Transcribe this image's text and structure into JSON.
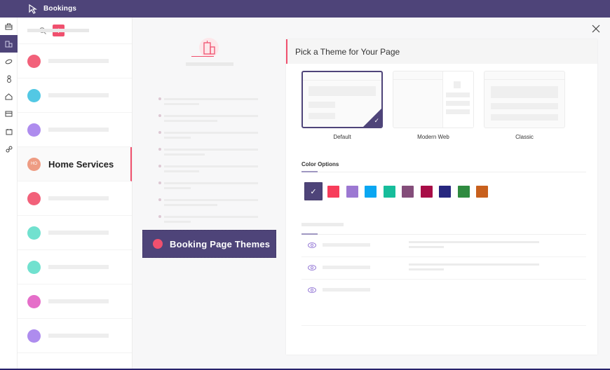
{
  "app": {
    "title": "Bookings",
    "logo_icon": "cursor-click-icon"
  },
  "rail": {
    "items": [
      {
        "icon": "briefcase-icon",
        "active": false
      },
      {
        "icon": "building-icon",
        "active": true
      },
      {
        "icon": "cap-icon",
        "active": false
      },
      {
        "icon": "user-icon",
        "active": false
      },
      {
        "icon": "home-icon",
        "active": false
      },
      {
        "icon": "card-icon",
        "active": false
      },
      {
        "icon": "calendar-icon",
        "active": false
      },
      {
        "icon": "link-icon",
        "active": false
      }
    ]
  },
  "list": {
    "search_icon": "search-icon",
    "add_label": "+",
    "items": [
      {
        "color": "#f2617a"
      },
      {
        "color": "#53c8e4"
      },
      {
        "color": "#ae8cee"
      },
      {
        "color": "#ee9c83",
        "initials": "HO",
        "name": "Home Services",
        "selected": true
      },
      {
        "color": "#f2617a"
      },
      {
        "color": "#71e1cf"
      },
      {
        "color": "#71e1cf"
      },
      {
        "color": "#e56ec9"
      },
      {
        "color": "#ae8cee"
      }
    ]
  },
  "middle": {
    "callout_label": "Booking Page Themes",
    "callout_dot_color": "#f0506e",
    "bullet_count": 8
  },
  "panel": {
    "title": "Pick a Theme for Your Page",
    "themes": [
      {
        "label": "Default",
        "selected": true
      },
      {
        "label": "Modern Web",
        "selected": false
      },
      {
        "label": "Classic",
        "selected": false
      }
    ],
    "color_options_label": "Color Options",
    "colors": [
      "#4e4479",
      "#f73d5b",
      "#9c78d2",
      "#0aa7f2",
      "#17bd9b",
      "#844d7a",
      "#a80d47",
      "#27277f",
      "#2f8b40",
      "#c8601d"
    ],
    "selected_color": "#4e4479",
    "rows": 3
  },
  "close_icon": "close-icon"
}
